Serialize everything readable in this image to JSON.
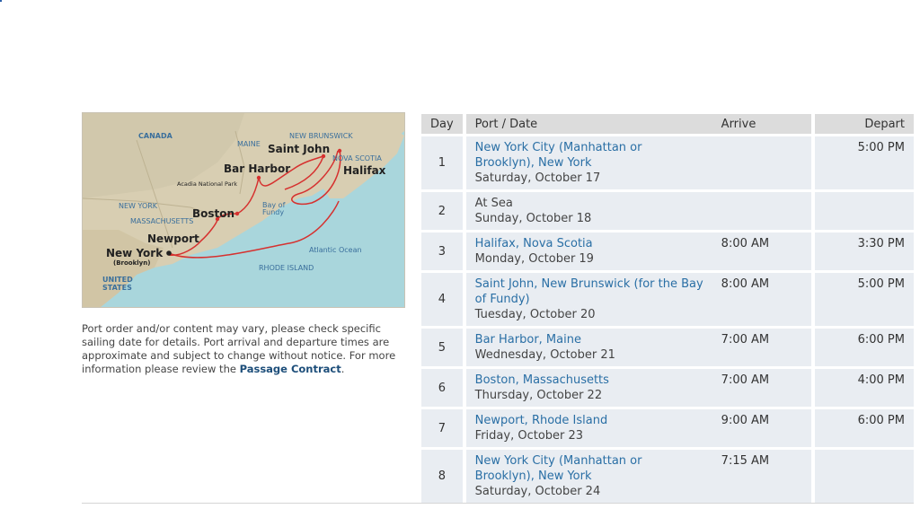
{
  "map": {
    "labels": {
      "canada": "CANADA",
      "maine": "MAINE",
      "new_brunswick": "NEW BRUNSWICK",
      "nova_scotia": "NOVA SCOTIA",
      "saint_john": "Saint John",
      "bar_harbor": "Bar Harbor",
      "halifax": "Halifax",
      "acadia": "Acadia National Park",
      "new_york_state": "NEW YORK",
      "massachusetts": "MASSACHUSETTS",
      "boston": "Boston",
      "bay_of": "Bay of",
      "fundy": "Fundy",
      "newport": "Newport",
      "atlantic": "Atlantic Ocean",
      "new_york_city": "New York",
      "brooklyn": "(Brooklyn)",
      "rhode_island": "RHODE ISLAND",
      "united": "UNITED",
      "states": "STATES"
    },
    "colors": {
      "land": "#d9cfb3",
      "water": "#a9d6dc",
      "route": "#d6312f"
    }
  },
  "notice": {
    "text": "Port order and/or content may vary, please check specific sailing date for details. Port arrival and departure times are approximate and subject to change without notice. For more information please review the ",
    "link": "Passage Contract",
    "end": "."
  },
  "table": {
    "headers": {
      "day": "Day",
      "port": "Port / Date",
      "arrive": "Arrive",
      "depart": "Depart"
    },
    "rows": [
      {
        "day": "1",
        "port": "New York City (Manhattan or Brooklyn), New York",
        "date": "Saturday, October 17",
        "arrive": "",
        "depart": "5:00 PM",
        "linked": true
      },
      {
        "day": "2",
        "port": "At Sea",
        "date": "Sunday, October 18",
        "arrive": "",
        "depart": "",
        "linked": false
      },
      {
        "day": "3",
        "port": "Halifax, Nova Scotia",
        "date": "Monday, October 19",
        "arrive": "8:00 AM",
        "depart": "3:30 PM",
        "linked": true
      },
      {
        "day": "4",
        "port": "Saint John, New Brunswick (for the Bay of Fundy)",
        "date": "Tuesday, October 20",
        "arrive": "8:00 AM",
        "depart": "5:00 PM",
        "linked": true
      },
      {
        "day": "5",
        "port": "Bar Harbor, Maine",
        "date": "Wednesday, October 21",
        "arrive": "7:00 AM",
        "depart": "6:00 PM",
        "linked": true
      },
      {
        "day": "6",
        "port": "Boston, Massachusetts",
        "date": "Thursday, October 22",
        "arrive": "7:00 AM",
        "depart": "4:00 PM",
        "linked": true
      },
      {
        "day": "7",
        "port": "Newport, Rhode Island",
        "date": "Friday, October 23",
        "arrive": "9:00 AM",
        "depart": "6:00 PM",
        "linked": true
      },
      {
        "day": "8",
        "port": "New York City (Manhattan or Brooklyn), New York",
        "date": "Saturday, October 24",
        "arrive": "7:15 AM",
        "depart": "",
        "linked": true
      }
    ]
  }
}
